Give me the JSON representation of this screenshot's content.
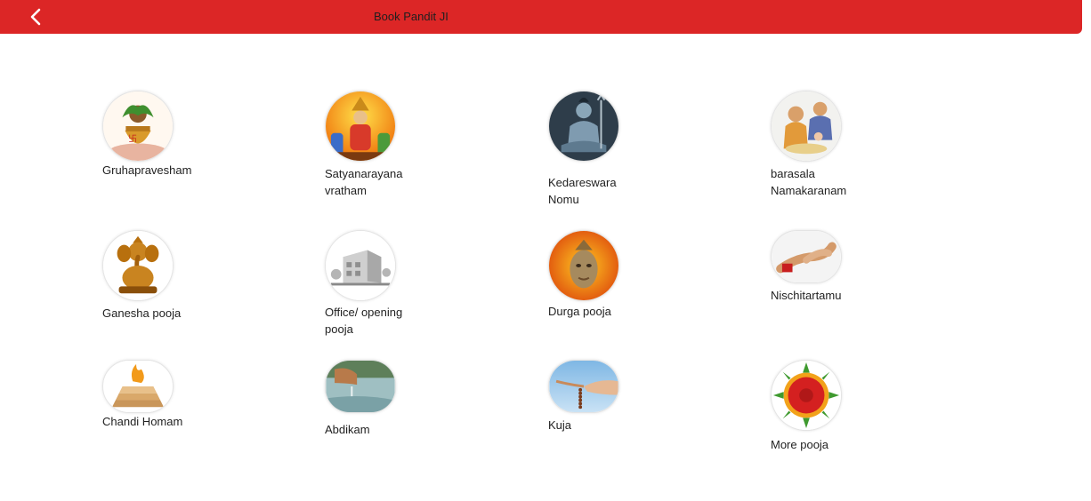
{
  "header": {
    "title": "Book Pandit JI",
    "back_icon": "chevron-left-icon"
  },
  "colors": {
    "header": "#dc2626",
    "background": "#ffffff"
  },
  "services": [
    {
      "label": "Gruhapravesham",
      "icon": "kalash-icon"
    },
    {
      "label": "Satyanarayana vratham",
      "icon": "satyanarayana-icon"
    },
    {
      "label": "Kedareswara Nomu",
      "icon": "shiva-icon"
    },
    {
      "label": "barasala Namakaranam",
      "icon": "naming-ceremony-icon"
    },
    {
      "label": "Ganesha pooja",
      "icon": "ganesha-icon"
    },
    {
      "label": "Office/ opening pooja",
      "icon": "office-building-icon"
    },
    {
      "label": "Durga pooja",
      "icon": "durga-icon"
    },
    {
      "label": "Nischitartamu",
      "icon": "engagement-hands-icon"
    },
    {
      "label": "Chandi Homam",
      "icon": "homam-fire-icon"
    },
    {
      "label": "Abdikam",
      "icon": "water-offering-icon"
    },
    {
      "label": "Kuja",
      "icon": "rudraksha-hand-icon"
    },
    {
      "label": "More pooja",
      "icon": "flower-rangoli-icon"
    }
  ]
}
